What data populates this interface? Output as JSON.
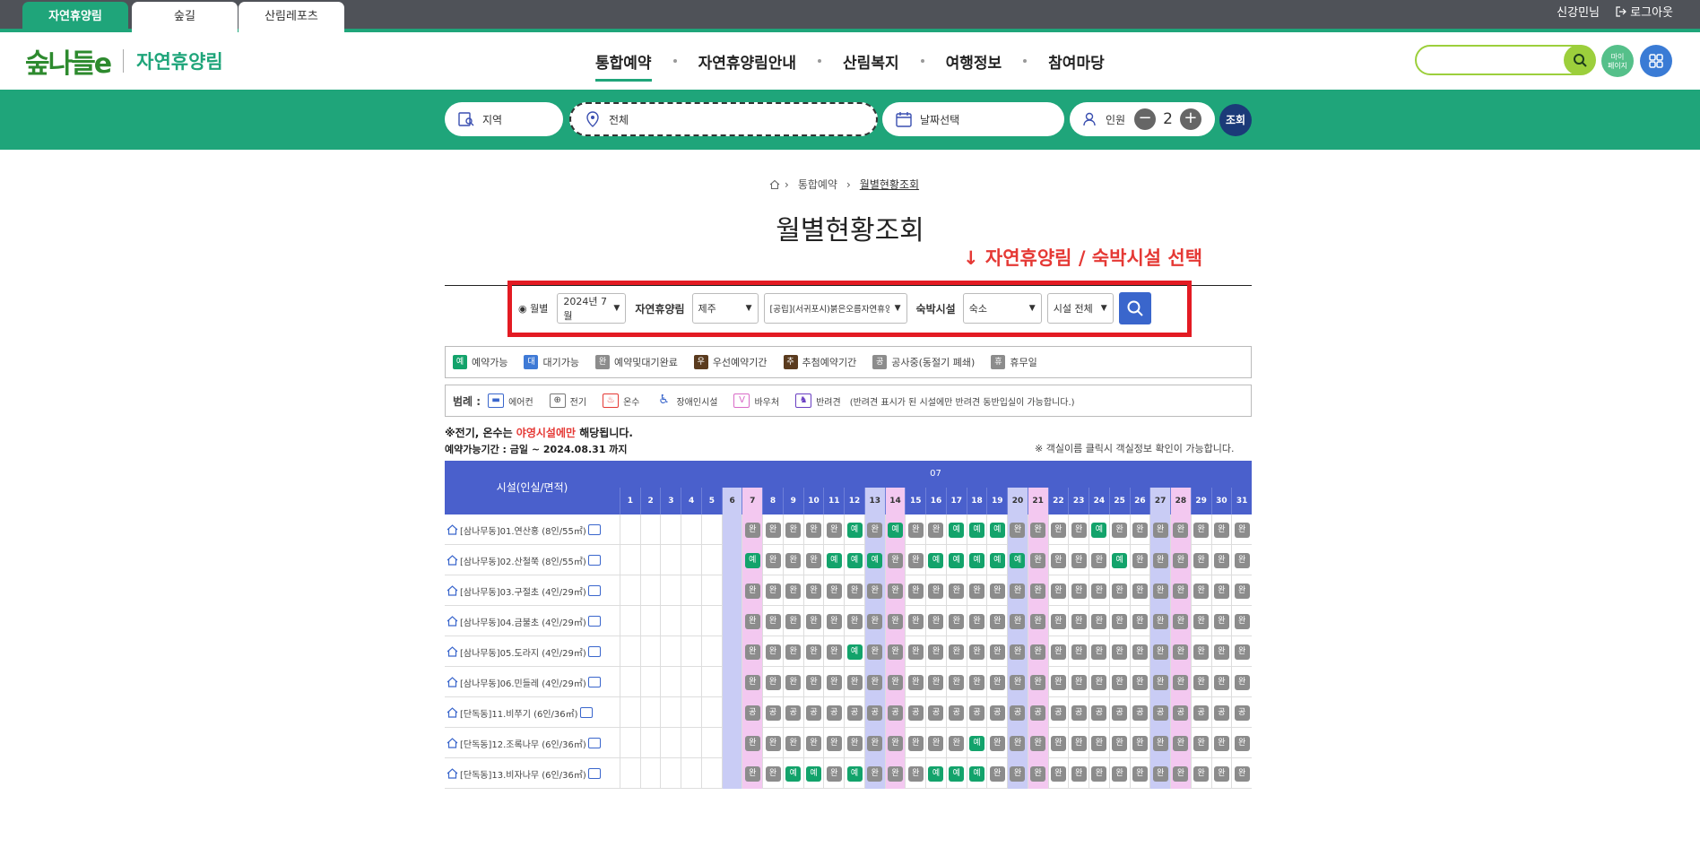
{
  "topbar": {
    "tabs": [
      "자연휴양림",
      "숲길",
      "산림레포츠"
    ],
    "user": "신강민님",
    "logout": "로그아웃"
  },
  "header": {
    "logo": "숲나들e",
    "site_name": "자연휴양림",
    "gnb": [
      "통합예약",
      "자연휴양림안내",
      "산림복지",
      "여행정보",
      "참여마당"
    ],
    "mypage": "마이\n페이지"
  },
  "strip": {
    "region": "지역",
    "all": "전체",
    "date": "날짜선택",
    "people_label": "인원",
    "people_value": "2",
    "go": "조회"
  },
  "breadcrumb": [
    "통합예약",
    "월별현황조회"
  ],
  "page_title": "월별현황조회",
  "annotation": "↓ 자연휴양림 / 숙박시설 선택",
  "filter": {
    "monthly": "◉ 월별",
    "month": "2024년 7월",
    "forest_label": "자연휴양림",
    "region": "제주",
    "forest": "[공립](서귀포시)붉은오름자연휴양림",
    "facility_label": "숙박시설",
    "facility": "숙소",
    "room": "시설 전체"
  },
  "legend1": [
    {
      "badge": "예",
      "label": "예약가능",
      "color": "#13a36b"
    },
    {
      "badge": "대",
      "label": "대기가능",
      "color": "#3f7ad6"
    },
    {
      "badge": "완",
      "label": "예약및대기완료",
      "color": "#8c8c8c"
    },
    {
      "badge": "우",
      "label": "우선예약기간",
      "color": "#5a3b1e"
    },
    {
      "badge": "추",
      "label": "추첨예약기간",
      "color": "#5a3b1e"
    },
    {
      "badge": "공",
      "label": "공사중(동절기 폐쇄)",
      "color": "#8c8c8c"
    },
    {
      "badge": "휴",
      "label": "휴무일",
      "color": "#8c8c8c"
    }
  ],
  "legend2": {
    "title": "범례 :",
    "items": [
      "에어컨",
      "전기",
      "온수",
      "장애인시설",
      "바우처",
      "반려견"
    ],
    "note": "(반려견 표시가 된 시설에만 반려견 동반입실이 가능합니다.)"
  },
  "notes": {
    "line1_a": "※전기, 온수는 ",
    "line1_red": "야영시설에만",
    "line1_b": " 해당됩니다.",
    "period": "예약가능기간 : 금일 ~ 2024.08.31 까지",
    "right": "※ 객실이름 클릭시 객실정보 확인이 가능합니다."
  },
  "calendar": {
    "head": "시설(인실/면적)",
    "month": "07",
    "days": [
      "1",
      "2",
      "3",
      "4",
      "5",
      "6",
      "7",
      "8",
      "9",
      "10",
      "11",
      "12",
      "13",
      "14",
      "15",
      "16",
      "17",
      "18",
      "19",
      "20",
      "21",
      "22",
      "23",
      "24",
      "25",
      "26",
      "27",
      "28",
      "29",
      "30",
      "31"
    ],
    "sat_days": [
      6,
      13,
      20,
      27
    ],
    "sun_days": [
      7,
      14,
      21,
      28
    ],
    "rows": [
      {
        "name": "[삼나무동]01.연산홍 (8인/55㎡)",
        "cells": [
          "",
          "",
          "",
          "",
          "",
          "",
          "완",
          "완",
          "완",
          "완",
          "완",
          "예",
          "완",
          "예",
          "완",
          "완",
          "예",
          "예",
          "예",
          "완",
          "완",
          "완",
          "완",
          "예",
          "완",
          "완",
          "완",
          "완",
          "완",
          "완",
          "완"
        ]
      },
      {
        "name": "[삼나무동]02.산철쭉 (8인/55㎡)",
        "cells": [
          "",
          "",
          "",
          "",
          "",
          "",
          "예",
          "완",
          "완",
          "완",
          "예",
          "예",
          "예",
          "완",
          "완",
          "예",
          "예",
          "예",
          "예",
          "예",
          "완",
          "완",
          "완",
          "완",
          "예",
          "완",
          "완",
          "완",
          "완",
          "완",
          "완"
        ]
      },
      {
        "name": "[삼나무동]03.구절초 (4인/29㎡)",
        "cells": [
          "",
          "",
          "",
          "",
          "",
          "",
          "완",
          "완",
          "완",
          "완",
          "완",
          "완",
          "완",
          "완",
          "완",
          "완",
          "완",
          "완",
          "완",
          "완",
          "완",
          "완",
          "완",
          "완",
          "완",
          "완",
          "완",
          "완",
          "완",
          "완",
          "완"
        ]
      },
      {
        "name": "[삼나무동]04.금불초 (4인/29㎡)",
        "cells": [
          "",
          "",
          "",
          "",
          "",
          "",
          "완",
          "완",
          "완",
          "완",
          "완",
          "완",
          "완",
          "완",
          "완",
          "완",
          "완",
          "완",
          "완",
          "완",
          "완",
          "완",
          "완",
          "완",
          "완",
          "완",
          "완",
          "완",
          "완",
          "완",
          "완"
        ]
      },
      {
        "name": "[삼나무동]05.도라지 (4인/29㎡)",
        "cells": [
          "",
          "",
          "",
          "",
          "",
          "",
          "완",
          "완",
          "완",
          "완",
          "완",
          "예",
          "완",
          "완",
          "완",
          "완",
          "완",
          "완",
          "완",
          "완",
          "완",
          "완",
          "완",
          "완",
          "완",
          "완",
          "완",
          "완",
          "완",
          "완",
          "완"
        ]
      },
      {
        "name": "[삼나무동]06.민들레 (4인/29㎡)",
        "cells": [
          "",
          "",
          "",
          "",
          "",
          "",
          "완",
          "완",
          "완",
          "완",
          "완",
          "완",
          "완",
          "완",
          "완",
          "완",
          "완",
          "완",
          "완",
          "완",
          "완",
          "완",
          "완",
          "완",
          "완",
          "완",
          "완",
          "완",
          "완",
          "완",
          "완"
        ]
      },
      {
        "name": "[단독동]11.비쭈기 (6인/36㎡)",
        "cells": [
          "",
          "",
          "",
          "",
          "",
          "",
          "공",
          "공",
          "공",
          "공",
          "공",
          "공",
          "공",
          "공",
          "공",
          "공",
          "공",
          "공",
          "공",
          "공",
          "공",
          "공",
          "공",
          "공",
          "공",
          "공",
          "공",
          "공",
          "공",
          "공",
          "공"
        ]
      },
      {
        "name": "[단독동]12.조록나무 (6인/36㎡)",
        "cells": [
          "",
          "",
          "",
          "",
          "",
          "",
          "완",
          "완",
          "완",
          "완",
          "완",
          "완",
          "완",
          "완",
          "완",
          "완",
          "완",
          "예",
          "완",
          "완",
          "완",
          "완",
          "완",
          "완",
          "완",
          "완",
          "완",
          "완",
          "완",
          "완",
          "완"
        ]
      },
      {
        "name": "[단독동]13.비자나무 (6인/36㎡)",
        "cells": [
          "",
          "",
          "",
          "",
          "",
          "",
          "완",
          "완",
          "예",
          "예",
          "완",
          "예",
          "완",
          "완",
          "완",
          "예",
          "예",
          "예",
          "완",
          "완",
          "완",
          "완",
          "완",
          "완",
          "완",
          "완",
          "완",
          "완",
          "완",
          "완",
          "완"
        ]
      }
    ]
  },
  "colors": {
    "green": "#1fa57a",
    "avail": "#13a36b",
    "done": "#8c8c8c",
    "blue": "#4a60cc",
    "red": "#e53935"
  }
}
